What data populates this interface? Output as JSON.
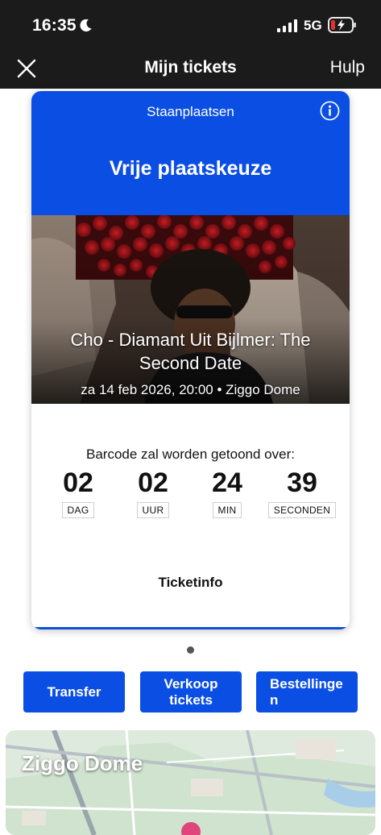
{
  "status_bar": {
    "time": "16:35",
    "network": "5G",
    "icons": [
      "moon-icon",
      "signal-icon",
      "battery-icon"
    ]
  },
  "nav": {
    "title": "Mijn tickets",
    "help_label": "Hulp",
    "close_icon": "close-icon"
  },
  "ticket": {
    "section": "Staanplaatsen",
    "seat_type": "Vrije plaatskeuze",
    "event_title": "Cho - Diamant Uit Bijlmer: The Second Date",
    "event_meta": "za 14 feb 2026, 20:00 • Ziggo Dome",
    "countdown": {
      "caption": "Barcode zal worden getoond over:",
      "units": [
        {
          "value": "02",
          "label": "DAG"
        },
        {
          "value": "02",
          "label": "UUR"
        },
        {
          "value": "24",
          "label": "MIN"
        },
        {
          "value": "39",
          "label": "SECONDEN"
        }
      ]
    },
    "ticketinfo_label": "Ticketinfo"
  },
  "actions": {
    "transfer": "Transfer",
    "sell": "Verkoop tickets",
    "orders": "Bestellingen"
  },
  "map": {
    "venue": "Ziggo Dome"
  },
  "colors": {
    "brand_blue": "#0b4ee3",
    "status_bar_bg": "#1b1b1b",
    "battery_low": "#e5322e"
  }
}
